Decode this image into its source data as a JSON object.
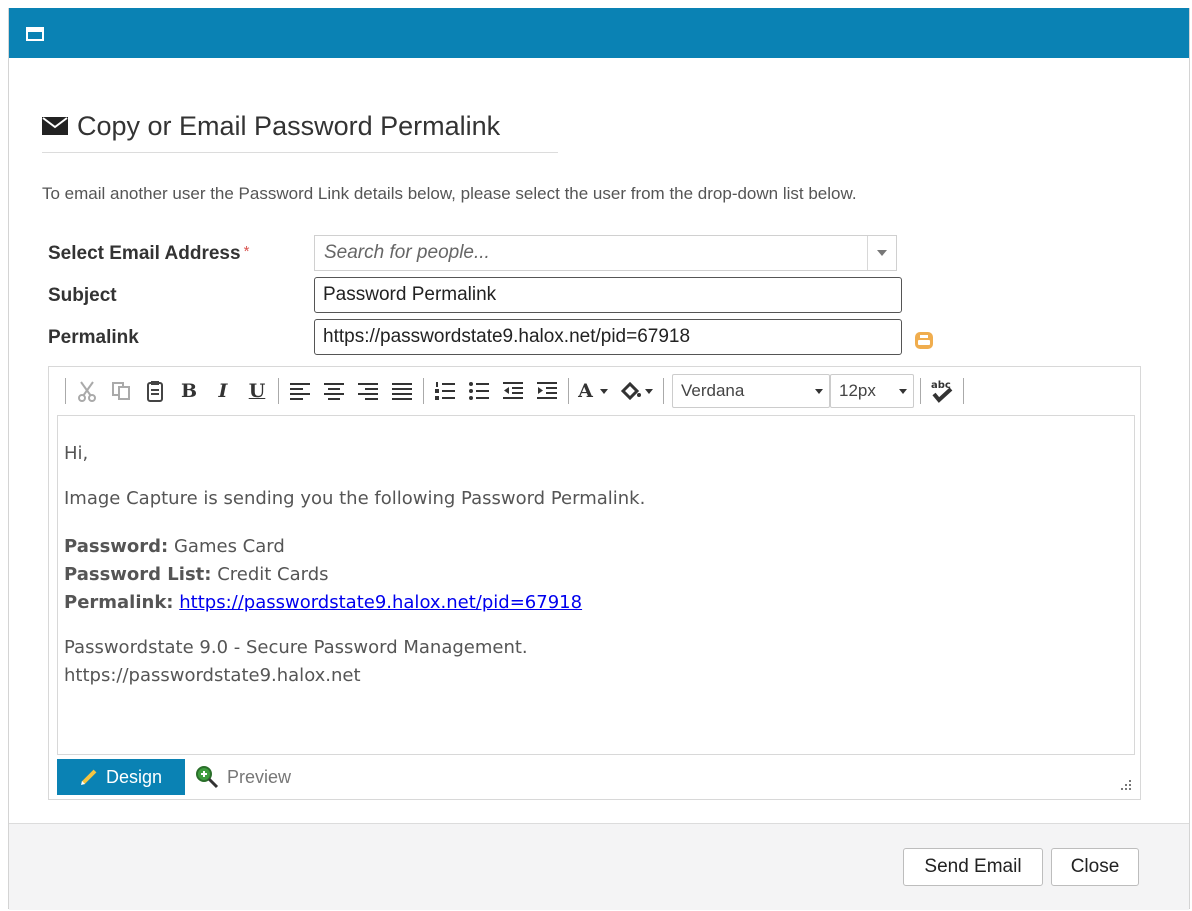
{
  "dialog": {
    "title": "Copy or Email Password Permalink",
    "intro": "To email another user the Password Link details below, please select the user from the drop-down list below."
  },
  "form": {
    "email_label": "Select Email Address",
    "required_marker": "*",
    "email_placeholder": "Search for people...",
    "subject_label": "Subject",
    "subject_value": "Password Permalink",
    "permalink_label": "Permalink",
    "permalink_value": "https://passwordstate9.halox.net/pid=67918"
  },
  "toolbar": {
    "bold": "B",
    "italic": "I",
    "underline": "U",
    "font_color": "A",
    "font_name": "Verdana",
    "font_size": "12px"
  },
  "body": {
    "greeting": "Hi,",
    "sender_line": "Image Capture is sending you the following Password Permalink.",
    "password_label": "Password:",
    "password_value": "Games Card",
    "list_label": "Password List:",
    "list_value": "Credit Cards",
    "permalink_label": "Permalink:",
    "permalink_link": "https://passwordstate9.halox.net/pid=67918",
    "signature_line": "Passwordstate 9.0 - Secure Password Management.",
    "signature_url": "https://passwordstate9.halox.net"
  },
  "modes": {
    "design": "Design",
    "preview": "Preview"
  },
  "footer": {
    "send_label": "Send Email",
    "close_label": "Close"
  },
  "colors": {
    "accent": "#0a82b4",
    "required": "#d9534f",
    "link": "#0000ee",
    "copy_icon": "#f0ad4e"
  },
  "icons": [
    "window-icon",
    "envelope-icon",
    "chevron-down-icon",
    "copy-to-clipboard-icon",
    "cut-icon",
    "copy-icon",
    "paste-icon",
    "align-left-icon",
    "align-center-icon",
    "align-right-icon",
    "justify-icon",
    "numbered-list-icon",
    "bullet-list-icon",
    "outdent-icon",
    "indent-icon",
    "highlight-icon",
    "spellcheck-icon",
    "pencil-icon",
    "magnifier-icon",
    "resize-grip-icon"
  ]
}
